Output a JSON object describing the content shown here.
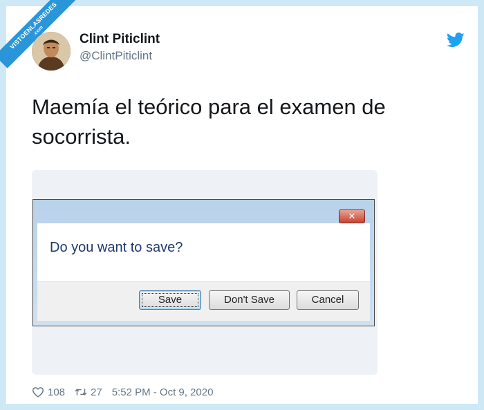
{
  "watermark": {
    "site": "VISTOENLASREDES",
    "tld": ".com"
  },
  "author": {
    "name": "Clint Piticlint",
    "handle": "@ClintPiticlint"
  },
  "tweet": {
    "text": "Maemía el teórico para el examen de socorrista."
  },
  "dialog": {
    "message": "Do you want to save?",
    "buttons": {
      "save": "Save",
      "dont_save": "Don't Save",
      "cancel": "Cancel"
    }
  },
  "stats": {
    "likes": "108",
    "retweets": "27",
    "timestamp": "5:52 PM - Oct 9, 2020"
  },
  "colors": {
    "twitter_blue": "#1da1f2",
    "frame": "#cfe8f6",
    "muted_text": "#657786"
  },
  "icons": {
    "platform": "twitter-bird-icon",
    "like": "heart-icon",
    "retweet": "retweet-icon",
    "dialog_close": "close-icon"
  }
}
